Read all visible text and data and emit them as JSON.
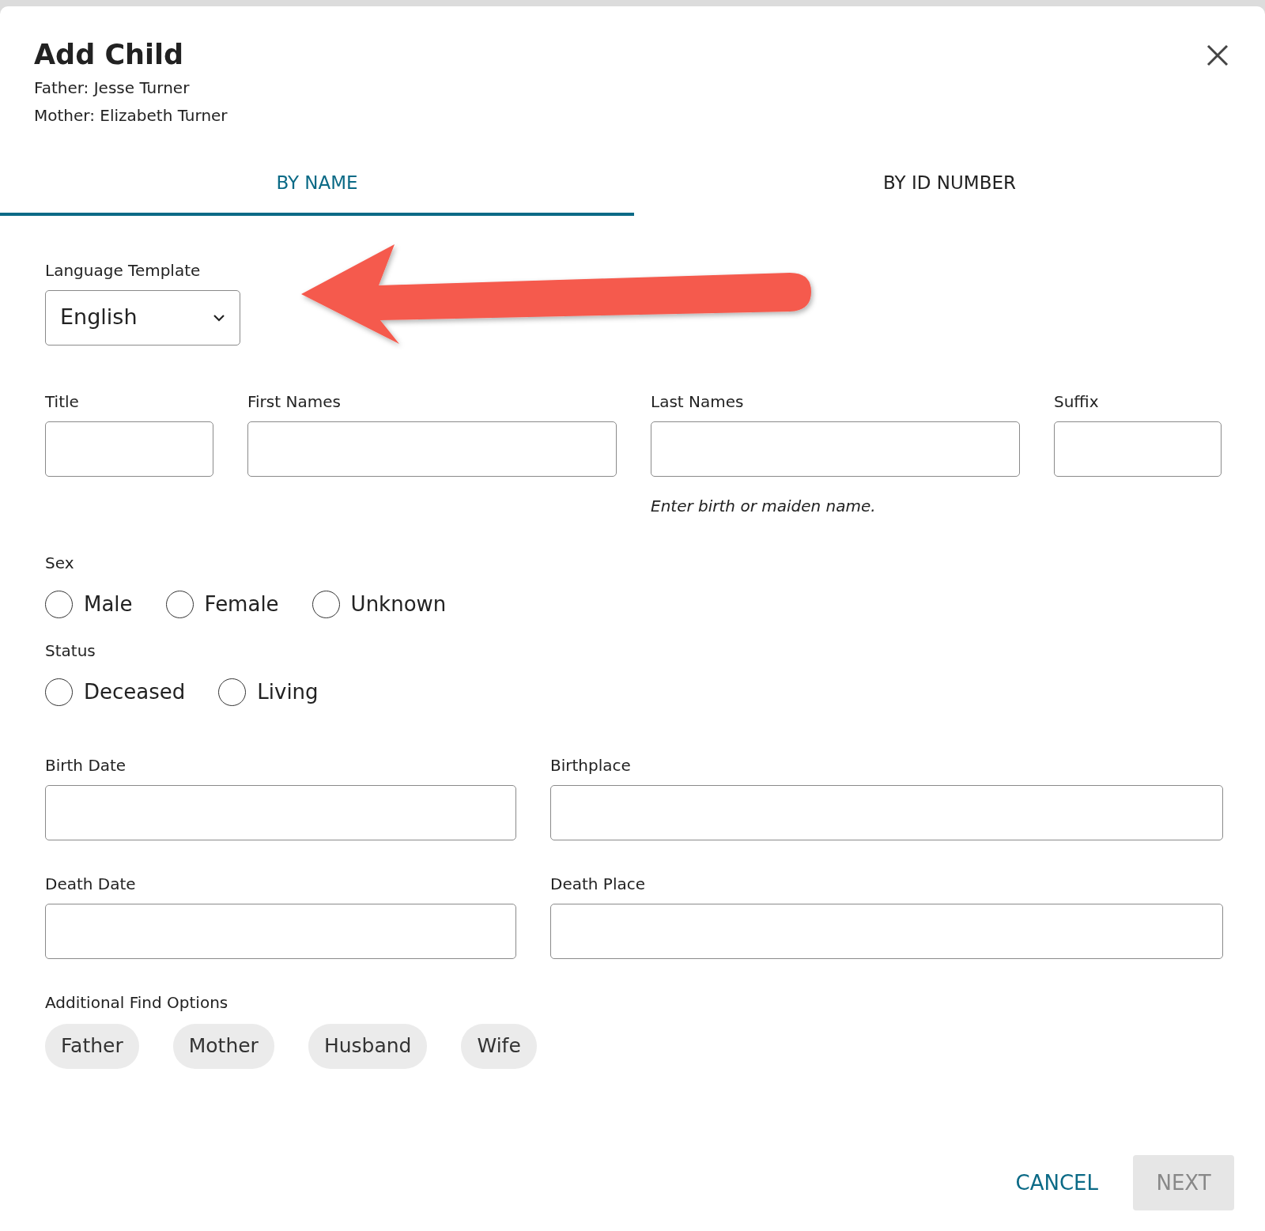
{
  "dialog": {
    "title": "Add Child",
    "subtitle_lines": [
      "Father: Jesse Turner",
      "Mother: Elizabeth Turner"
    ]
  },
  "tabs": [
    {
      "label": "BY NAME",
      "selected": true
    },
    {
      "label": "BY ID NUMBER",
      "selected": false
    }
  ],
  "language_template": {
    "label": "Language Template",
    "value": "English"
  },
  "name_fields": [
    {
      "label": "Title"
    },
    {
      "label": "First Names"
    },
    {
      "label": "Last Names",
      "hint": "Enter birth or maiden name."
    },
    {
      "label": "Suffix"
    }
  ],
  "radio_groups": [
    {
      "label": "Sex",
      "options": [
        {
          "label": "Male",
          "selected": false
        },
        {
          "label": "Female",
          "selected": false
        },
        {
          "label": "Unknown",
          "selected": false
        }
      ]
    },
    {
      "label": "Status",
      "options": [
        {
          "label": "Deceased",
          "selected": false
        },
        {
          "label": "Living",
          "selected": false
        }
      ]
    }
  ],
  "event_rows": [
    [
      {
        "label": "Birth Date"
      },
      {
        "label": "Birthplace"
      }
    ],
    [
      {
        "label": "Death Date"
      },
      {
        "label": "Death Place"
      }
    ]
  ],
  "additional_find_options": {
    "label": "Additional Find Options",
    "options": [
      "Father",
      "Mother",
      "Husband",
      "Wife"
    ]
  },
  "buttons": [
    {
      "kind": "link",
      "label": "CANCEL"
    },
    {
      "kind": "filled",
      "label": "NEXT",
      "disabled": true
    }
  ]
}
